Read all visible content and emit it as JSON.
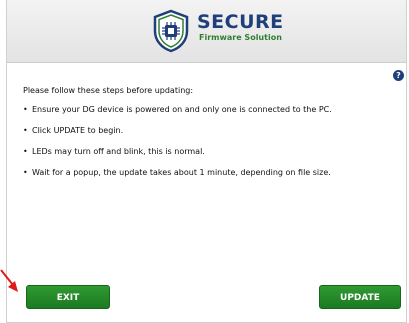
{
  "header": {
    "logo_title": "SECURE",
    "logo_subtitle": "Firmware Solution",
    "logo_icon": "chip-shield-icon",
    "brand_color": "#1e3f7a",
    "accent_color": "#2f7f32"
  },
  "help": {
    "icon": "help-icon",
    "glyph": "?"
  },
  "content": {
    "intro": "Please follow these steps before updating:",
    "steps": [
      "Ensure your DG device is powered on and only one is connected to the PC.",
      "Click UPDATE to begin.",
      "LEDs may turn off and blink, this is normal.",
      "Wait for a popup, the update takes about 1 minute, depending on file size."
    ]
  },
  "buttons": {
    "exit_label": "EXIT",
    "update_label": "UPDATE",
    "color": "#2a8c2e"
  },
  "annotation": {
    "arrow_color": "#e01919",
    "target": "exit-button"
  }
}
